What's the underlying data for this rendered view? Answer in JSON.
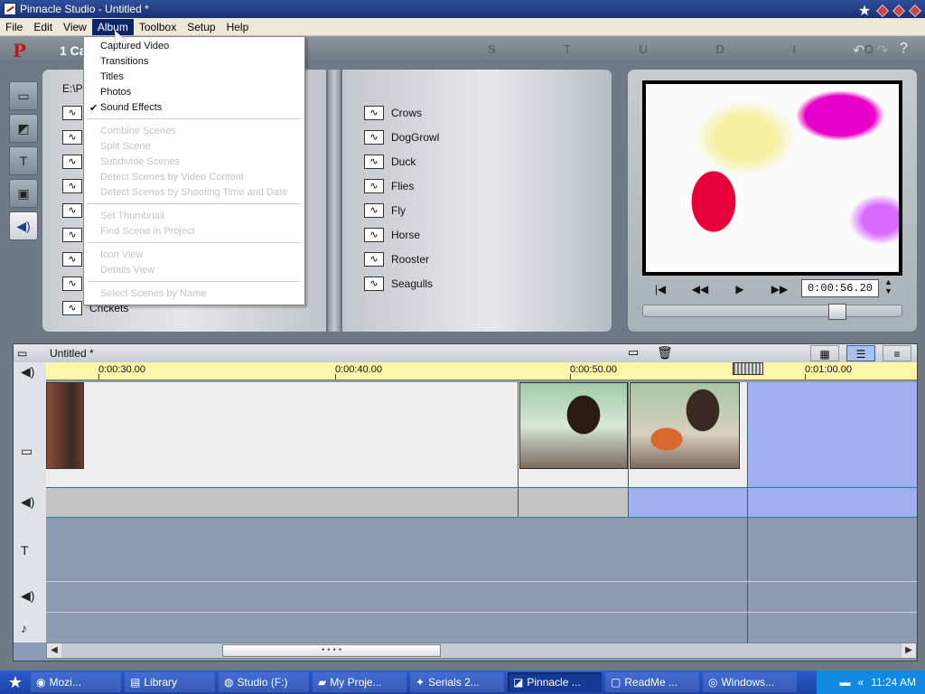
{
  "window": {
    "title": "Pinnacle Studio - Untitled *"
  },
  "menubar": {
    "items": [
      "File",
      "Edit",
      "View",
      "Album",
      "Toolbox",
      "Setup",
      "Help"
    ],
    "active_index": 3
  },
  "studiobar": {
    "step_label": "1 Ca",
    "studio_letters": "S T U D I O"
  },
  "album": {
    "path": "E:\\Pr",
    "left_list_last": "Crickets",
    "right_list": [
      "Crows",
      "DogGrowl",
      "Duck",
      "Flies",
      "Fly",
      "Horse",
      "Rooster",
      "Seagulls"
    ]
  },
  "album_menu": {
    "items": [
      {
        "label": "Captured Video",
        "enabled": true,
        "checked": false
      },
      {
        "label": "Transitions",
        "enabled": true,
        "checked": false
      },
      {
        "label": "Titles",
        "enabled": true,
        "checked": false
      },
      {
        "label": "Photos",
        "enabled": true,
        "checked": false
      },
      {
        "label": "Sound Effects",
        "enabled": true,
        "checked": true
      },
      {
        "label": "Combine Scenes",
        "enabled": false
      },
      {
        "label": "Split Scene",
        "enabled": false
      },
      {
        "label": "Subdivide Scenes",
        "enabled": false
      },
      {
        "label": "Detect Scenes by Video Content",
        "enabled": false
      },
      {
        "label": "Detect Scenes by Shooting Time and Date",
        "enabled": false
      },
      {
        "label": "Set Thumbnail",
        "enabled": false
      },
      {
        "label": "Find Scene in Project",
        "enabled": false
      },
      {
        "label": "Icon View",
        "enabled": false
      },
      {
        "label": "Details View",
        "enabled": false
      },
      {
        "label": "Select Scenes by Name",
        "enabled": false
      }
    ]
  },
  "player": {
    "timecode": "0:00:56.20",
    "position_fraction": 0.77
  },
  "timeline": {
    "title": "Untitled *",
    "ruler_labels": [
      "0:00:30.00",
      "0:00:40.00",
      "0:00:50.00",
      "0:01:00.00"
    ]
  },
  "taskbar": {
    "tasks": [
      {
        "label": "Mozi...",
        "icon": "firefox-icon",
        "active": false
      },
      {
        "label": "Library",
        "icon": "library-icon",
        "active": false
      },
      {
        "label": "Studio (F:)",
        "icon": "drive-icon",
        "active": false
      },
      {
        "label": "My Proje...",
        "icon": "folder-icon",
        "active": false
      },
      {
        "label": "Serials 2...",
        "icon": "app-icon",
        "active": false
      },
      {
        "label": "Pinnacle ...",
        "icon": "pinnacle-icon",
        "active": true
      },
      {
        "label": "ReadMe ...",
        "icon": "doc-icon",
        "active": false
      },
      {
        "label": "Windows...",
        "icon": "media-icon",
        "active": false
      }
    ],
    "clock": "11:24 AM"
  }
}
